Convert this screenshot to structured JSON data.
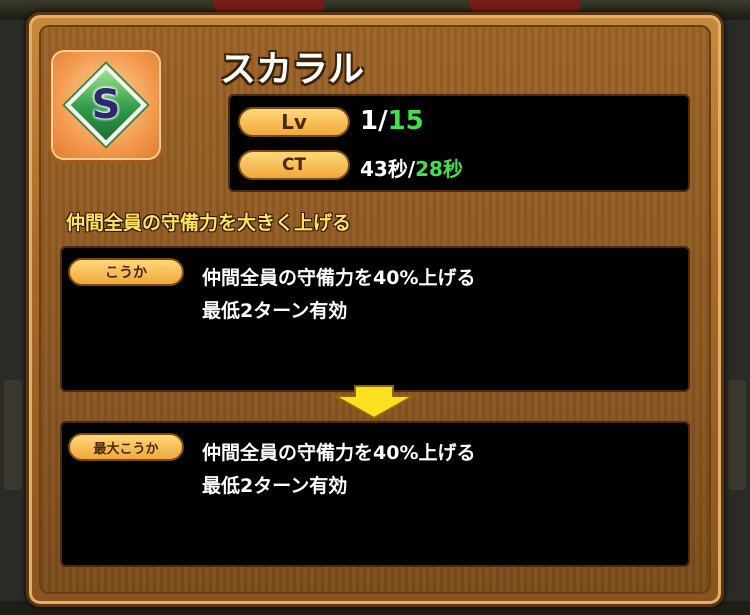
{
  "skill": {
    "name": "スカラル",
    "icon_letter": "S",
    "level_label": "Lv",
    "level_current": "1/",
    "level_max": "15",
    "ct_label": "CT",
    "ct_current": "43秒/",
    "ct_min": "28秒",
    "summary": "仲間全員の守備力を大きく上げる"
  },
  "effects": {
    "current_tag": "こうか",
    "current_line1": "仲間全員の守備力を40%上げる",
    "current_line2": "最低2ターン有効",
    "max_tag": "最大こうか",
    "max_line1": "仲間全員の守備力を40%上げる",
    "max_line2": "最低2ターン有効"
  },
  "colors": {
    "accent_green": "#44e04a",
    "subtitle_yellow": "#ffe35a",
    "panel_brown": "#9b6226"
  }
}
